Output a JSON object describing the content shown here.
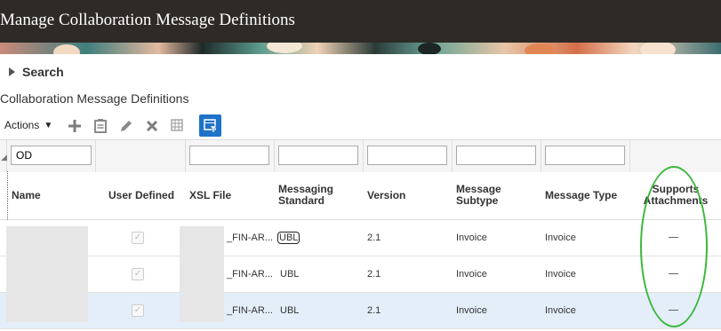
{
  "header": {
    "title": "Manage Collaboration Message Definitions"
  },
  "search": {
    "label": "Search"
  },
  "section": {
    "title": "Collaboration Message Definitions"
  },
  "toolbar": {
    "actions_label": "Actions",
    "icons": [
      "add-icon",
      "view-icon",
      "edit-icon",
      "delete-icon",
      "freeze-icon",
      "query-by-example-icon"
    ],
    "accent_color": "#1e73c8"
  },
  "filters": {
    "name": "OD",
    "xsl_file": "",
    "messaging_standard": "",
    "version": "",
    "message_subtype": "",
    "message_type": ""
  },
  "columns": {
    "name": "Name",
    "user_defined": "User Defined",
    "xsl_file": "XSL File",
    "messaging_standard_1": "Messaging",
    "messaging_standard_2": "Standard",
    "version": "Version",
    "message_subtype_1": "Message",
    "message_subtype_2": "Subtype",
    "message_type": "Message Type",
    "supports_attachments_1": "Supports",
    "supports_attachments_2": "Attachments"
  },
  "rows": [
    {
      "name_suffix": "..",
      "user_defined": true,
      "xsl_file": "_FIN-AR...",
      "messaging_standard": "UBL",
      "version": "2.1",
      "message_subtype": "Invoice",
      "message_type": "Invoice",
      "supports_attachments": "—",
      "selected": false
    },
    {
      "name_suffix": "..",
      "user_defined": true,
      "xsl_file": "_FIN-AR...",
      "messaging_standard": "UBL",
      "version": "2.1",
      "message_subtype": "Invoice",
      "message_type": "Invoice",
      "supports_attachments": "—",
      "selected": false
    },
    {
      "name_suffix": "..",
      "user_defined": true,
      "xsl_file": "_FIN-AR...",
      "messaging_standard": "UBL",
      "version": "2.1",
      "message_subtype": "Invoice",
      "message_type": "Invoice",
      "supports_attachments": "—",
      "selected": true
    }
  ],
  "annotation": {
    "highlight_color": "#3cb83c"
  }
}
